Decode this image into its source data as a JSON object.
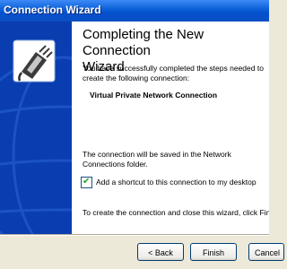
{
  "window": {
    "title": "Connection Wizard"
  },
  "main": {
    "heading": "Completing the New Connection\nWizard",
    "intro": "You have successfully completed the steps needed to\ncreate the following connection:",
    "connection_name": "Virtual Private Network Connection",
    "save_text": "The connection will be saved in the Network\nConnections folder.",
    "shortcut_label": "Add a shortcut to this connection to my desktop",
    "shortcut_checked": true,
    "finish_text": "To create the connection and close this wizard, click Finish."
  },
  "buttons": {
    "back": "< Back",
    "finish": "Finish",
    "cancel": "Cancel"
  },
  "colors": {
    "title_bar": "#0a5fd6",
    "sidebar": "#0a3db0",
    "dialog": "#ece9d8",
    "content": "#ffffff"
  }
}
